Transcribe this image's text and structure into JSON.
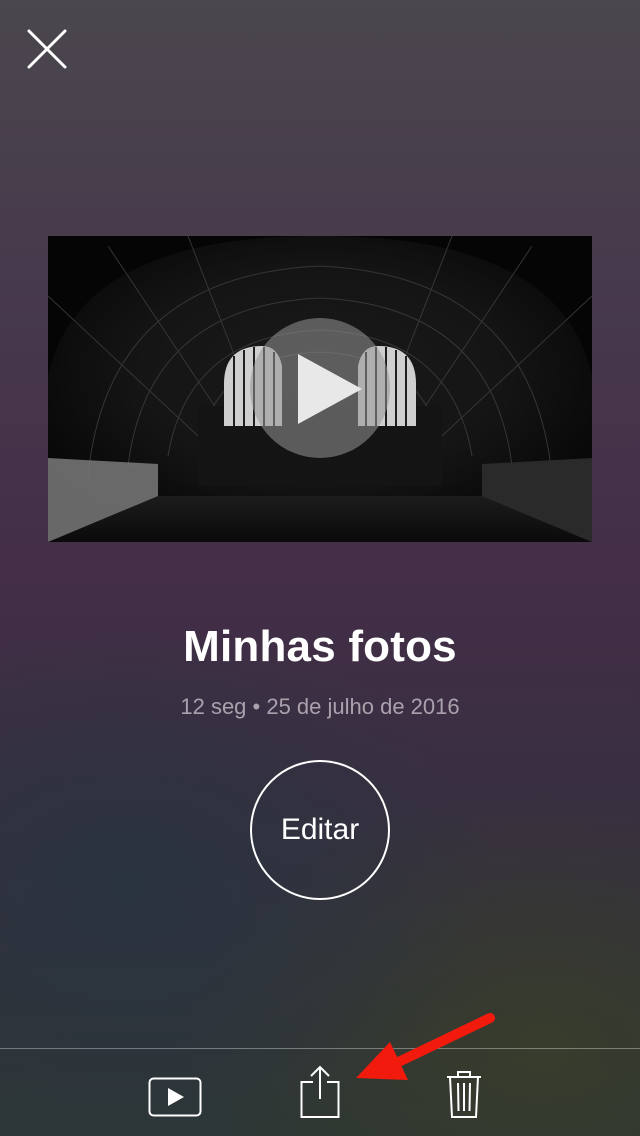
{
  "header": {
    "close_icon": "close-icon"
  },
  "video": {
    "thumbnail": "tunnel-arch-window",
    "play_icon": "play-icon"
  },
  "memory": {
    "title": "Minhas fotos",
    "meta": "12 seg • 25 de julho de 2016"
  },
  "actions": {
    "edit_label": "Editar"
  },
  "toolbar": {
    "items": [
      {
        "icon": "slideshow-play-icon"
      },
      {
        "icon": "share-icon"
      },
      {
        "icon": "trash-icon"
      }
    ]
  },
  "annotation": {
    "arrow_color": "#f21a0c",
    "points_to": "share-icon"
  },
  "colors": {
    "text_primary": "#ffffff",
    "text_secondary": "#a9a2ad"
  }
}
